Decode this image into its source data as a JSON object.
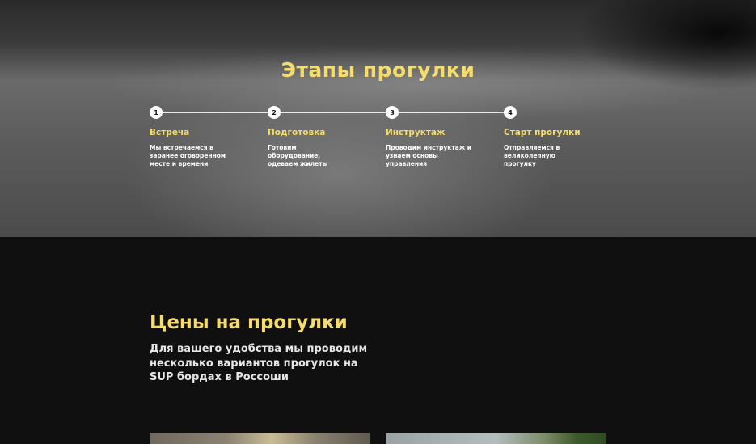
{
  "stages": {
    "title": "Этапы прогулки",
    "steps": [
      {
        "number": "1",
        "title": "Встреча",
        "text": "Мы встречаемся в заранее оговоренном месте и времени"
      },
      {
        "number": "2",
        "title": "Подготовка",
        "text": "Готовим оборудование, одеваем жилеты"
      },
      {
        "number": "3",
        "title": "Инструктаж",
        "text": "Проводим инструктаж и узнаем основы управления"
      },
      {
        "number": "4",
        "title": "Старт прогулки",
        "text": "Отправляемся в великолепную прогулку"
      }
    ]
  },
  "prices": {
    "title": "Цены на прогулки",
    "description": "Для вашего удобства мы проводим несколько вариантов прогулок на SUP бордах в Россоши"
  },
  "colors": {
    "accent": "#f5dc6b",
    "dark_background": "#101010"
  }
}
